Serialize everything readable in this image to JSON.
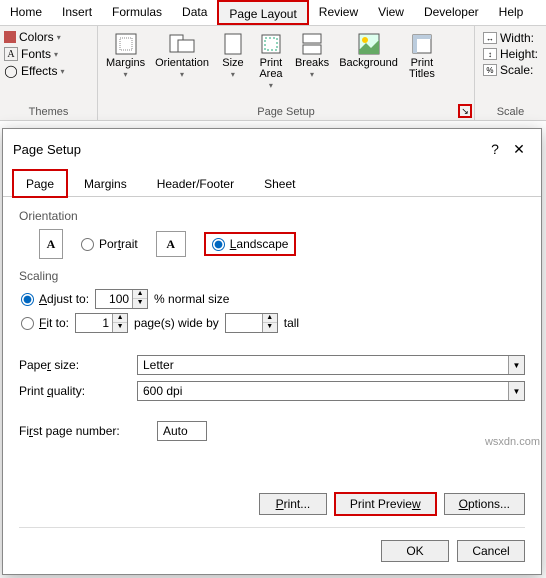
{
  "ribbon": {
    "tabs": [
      "Home",
      "Insert",
      "Formulas",
      "Data",
      "Page Layout",
      "Review",
      "View",
      "Developer",
      "Help"
    ],
    "themes": {
      "colors": "Colors",
      "fonts": "Fonts",
      "effects": "Effects",
      "group": "Themes"
    },
    "pgsetup": {
      "margins": "Margins",
      "orientation": "Orientation",
      "size": "Size",
      "printarea": "Print\nArea",
      "breaks": "Breaks",
      "background": "Background",
      "titles": "Print\nTitles",
      "group": "Page Setup"
    },
    "scale": {
      "width": "Width:",
      "height": "Height:",
      "scale": "Scale:",
      "group": "Scale"
    }
  },
  "dialog": {
    "title": "Page Setup",
    "tabs": {
      "page": "Page",
      "margins": "Margins",
      "hf": "Header/Footer",
      "sheet": "Sheet"
    },
    "orientation": {
      "label": "Orientation",
      "portrait": "Portrait",
      "landscape": "Landscape"
    },
    "scaling": {
      "label": "Scaling",
      "adjust": "Adjust to:",
      "adjust_val": "100",
      "adjust_suffix": "% normal size",
      "fit": "Fit to:",
      "fit_w": "1",
      "fit_mid": "page(s) wide by",
      "fit_h": "",
      "fit_tail": "tall"
    },
    "paper": {
      "label": "Paper size:",
      "value": "Letter"
    },
    "quality": {
      "label": "Print quality:",
      "value": "600 dpi"
    },
    "firstpage": {
      "label": "First page number:",
      "value": "Auto"
    },
    "buttons": {
      "print": "Print...",
      "preview": "Print Preview",
      "options": "Options...",
      "ok": "OK",
      "cancel": "Cancel"
    }
  },
  "watermark": "wsxdn.com"
}
